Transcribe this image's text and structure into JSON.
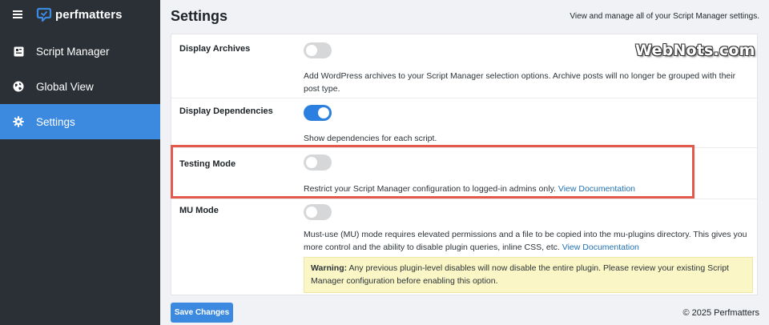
{
  "app": {
    "brand": "perfmatters",
    "menu_icon": "hamburger-menu-icon",
    "logo_icon": "perfmatters-logo-icon"
  },
  "sidebar": {
    "items": [
      {
        "label": "Script Manager",
        "icon": "script-manager-icon",
        "active": false
      },
      {
        "label": "Global View",
        "icon": "globe-icon",
        "active": false
      },
      {
        "label": "Settings",
        "icon": "gear-icon",
        "active": true
      }
    ]
  },
  "header": {
    "title": "Settings",
    "subtitle": "View and manage all of your Script Manager settings."
  },
  "settings": [
    {
      "label": "Display Archives",
      "enabled": false,
      "description": "Add WordPress archives to your Script Manager selection options. Archive posts will no longer be grouped with their post type."
    },
    {
      "label": "Display Dependencies",
      "enabled": true,
      "description": "Show dependencies for each script."
    },
    {
      "label": "Testing Mode",
      "enabled": false,
      "description": "Restrict your Script Manager configuration to logged-in admins only.",
      "link": "View Documentation",
      "highlighted": true
    },
    {
      "label": "MU Mode",
      "enabled": false,
      "description": "Must-use (MU) mode requires elevated permissions and a file to be copied into the mu-plugins directory. This gives you more control and the ability to disable plugin queries, inline CSS, etc.",
      "link": "View Documentation",
      "warning": {
        "label": "Warning:",
        "text": "Any previous plugin-level disables will now disable the entire plugin. Please review your existing Script Manager configuration before enabling this option."
      }
    }
  ],
  "footer": {
    "save_label": "Save Changes",
    "copyright": "© 2025 Perfmatters"
  },
  "watermark": "WebNots.com",
  "colors": {
    "sidebar_bg": "#2b3036",
    "accent": "#3c8ae0",
    "toggle_on": "#2b7fe0",
    "highlight_border": "#e35a4c",
    "warning_bg": "#faf6c6",
    "link": "#2271b1"
  }
}
